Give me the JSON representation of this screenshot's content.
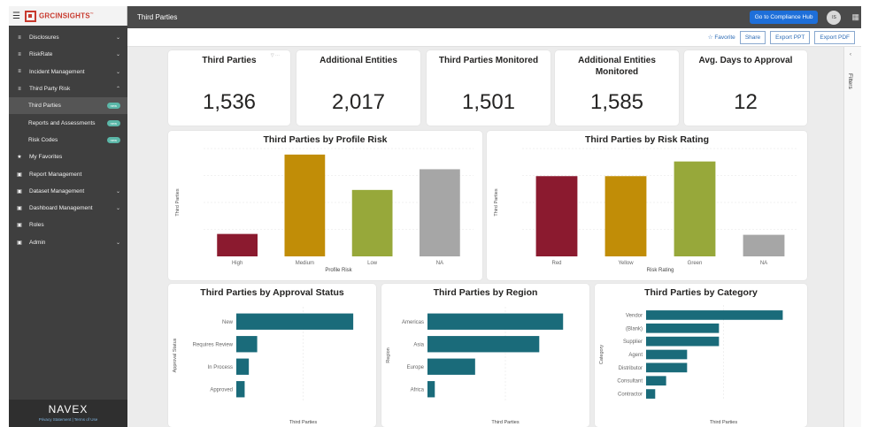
{
  "brand": {
    "logo_text": "GRCINSIGHTS",
    "logo_tm": "™",
    "footer_logo": "NAVEX",
    "footer_links": "Privacy Statement  |  Terms of Use"
  },
  "sidebar": {
    "items": [
      {
        "label": "Disclosures",
        "icon": "chart-icon",
        "chevron": "⌄"
      },
      {
        "label": "RiskRate",
        "icon": "chart-icon",
        "chevron": "⌄"
      },
      {
        "label": "Incident Management",
        "icon": "chart-icon",
        "chevron": "⌄"
      },
      {
        "label": "Third Party Risk",
        "icon": "chart-icon",
        "chevron": "⌃"
      },
      {
        "label": "Third Parties",
        "sub": true,
        "badge": "new",
        "active": true
      },
      {
        "label": "Reports and Assessments",
        "sub": true,
        "badge": "new"
      },
      {
        "label": "Risk Codes",
        "sub": true,
        "badge": "new"
      },
      {
        "label": "My Favorites",
        "icon": "star-icon"
      },
      {
        "label": "Report Management",
        "icon": "lock-icon"
      },
      {
        "label": "Dataset Management",
        "icon": "lock-icon",
        "chevron": "⌄"
      },
      {
        "label": "Dashboard Management",
        "icon": "lock-icon",
        "chevron": "⌄"
      },
      {
        "label": "Roles",
        "icon": "lock-icon"
      },
      {
        "label": "Admin",
        "icon": "lock-icon",
        "chevron": "⌄"
      }
    ]
  },
  "topbar": {
    "title": "Third Parties",
    "hub_button": "Go to Compliance Hub",
    "avatar": "IS"
  },
  "actions": {
    "favorite": "☆ Favorite",
    "share": "Share",
    "export_ppt": "Export PPT",
    "export_pdf": "Export PDF"
  },
  "filters_label": "Filters",
  "kpis": [
    {
      "title": "Third Parties",
      "value": "1,536"
    },
    {
      "title": "Additional Entities",
      "value": "2,017"
    },
    {
      "title": "Third Parties Monitored",
      "value": "1,501"
    },
    {
      "title": "Additional Entities Monitored",
      "value": "1,585"
    },
    {
      "title": "Avg. Days to Approval",
      "value": "12"
    }
  ],
  "chart_data": [
    {
      "type": "bar",
      "title": "Third Parties by Profile Risk",
      "xlabel": "Profile Risk",
      "ylabel": "Third Parties",
      "categories": [
        "High",
        "Medium",
        "Low",
        "NA"
      ],
      "values": [
        26,
        118,
        77,
        101
      ],
      "colors": [
        "#8b1a2f",
        "#c18d07",
        "#97a83a",
        "#a6a6a6"
      ],
      "ylim": [
        0,
        125
      ]
    },
    {
      "type": "bar",
      "title": "Third Parties by Risk Rating",
      "xlabel": "Risk Rating",
      "ylabel": "Third Parties",
      "categories": [
        "Red",
        "Yellow",
        "Green",
        "NA"
      ],
      "values": [
        93,
        93,
        110,
        25
      ],
      "colors": [
        "#8b1a2f",
        "#c18d07",
        "#97a83a",
        "#a6a6a6"
      ],
      "ylim": [
        0,
        125
      ]
    },
    {
      "type": "bar",
      "orientation": "horizontal",
      "title": "Third Parties by Approval Status",
      "xlabel": "Third Parties",
      "ylabel": "Approval Status",
      "categories": [
        "New",
        "Requires Review",
        "In Process",
        "Approved"
      ],
      "values": [
        140,
        25,
        15,
        10
      ],
      "color": "#1a6b7a",
      "xlim": [
        0,
        160
      ]
    },
    {
      "type": "bar",
      "orientation": "horizontal",
      "title": "Third Parties by Region",
      "xlabel": "Third Parties",
      "ylabel": "Region",
      "categories": [
        "Americas",
        "Asia",
        "Europe",
        "Africa"
      ],
      "values": [
        148,
        122,
        52,
        8
      ],
      "color": "#1a6b7a",
      "xlim": [
        0,
        170
      ]
    },
    {
      "type": "bar",
      "orientation": "horizontal",
      "title": "Third Parties by Category",
      "xlabel": "Third Parties",
      "ylabel": "Category",
      "categories": [
        "Vendor",
        "(Blank)",
        "Supplier",
        "Agent",
        "Distributor",
        "Consultant",
        "Contractor"
      ],
      "values": [
        150,
        80,
        80,
        45,
        45,
        22,
        10
      ],
      "color": "#1a6b7a",
      "xlim": [
        0,
        170
      ]
    }
  ]
}
